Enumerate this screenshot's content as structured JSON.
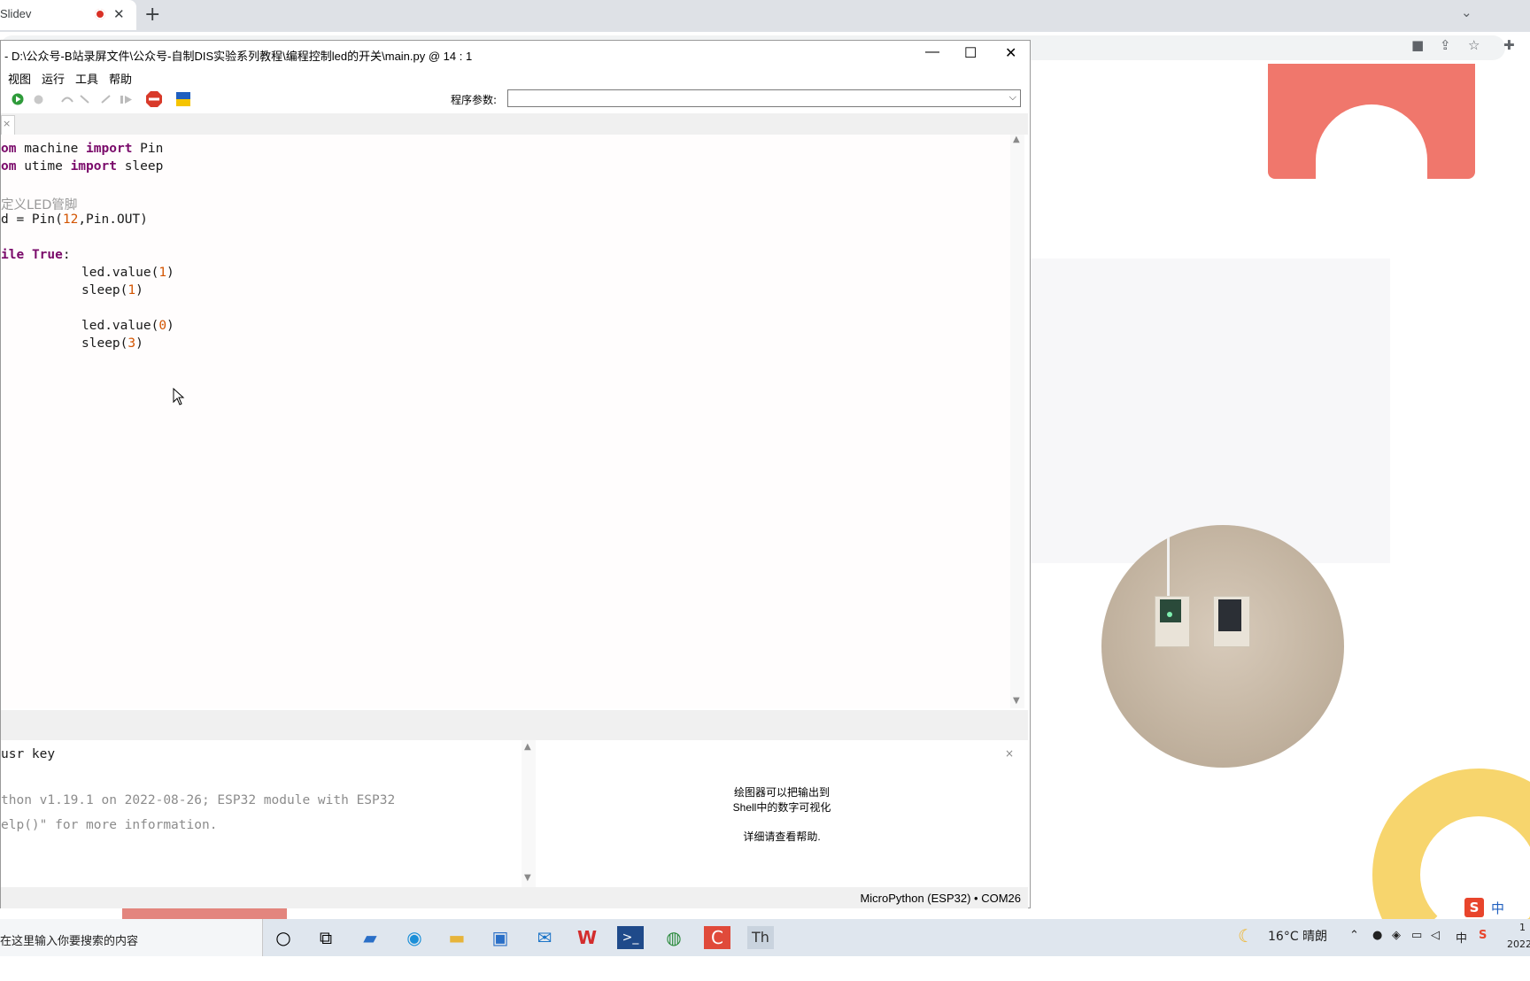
{
  "browser": {
    "tab_title": "Slidev",
    "tab_close": "✕",
    "new_tab": "+",
    "tab_search": "⌄"
  },
  "thonny": {
    "title": "- D:\\公众号-B站录屏文件\\公众号-自制DIS实验系列教程\\编程控制led的开关\\main.py  @  14 : 1",
    "window_buttons": {
      "minimize": "—",
      "maximize": "☐",
      "close": "✕"
    },
    "menu": [
      "视图",
      "运行",
      "工具",
      "帮助"
    ],
    "args_label": "程序参数:",
    "args_value": "",
    "editor_tab_close": "×",
    "code": {
      "l1_a": "om",
      "l1_b": " machine ",
      "l1_c": "import",
      "l1_d": " Pin",
      "l2_a": "om",
      "l2_b": " utime ",
      "l2_c": "import",
      "l2_d": " sleep",
      "l4": "定义LED管脚",
      "l5_a": "d = Pin(",
      "l5_b": "12",
      "l5_c": ",Pin.OUT)",
      "l7_a": "ile",
      "l7_b": " ",
      "l7_c": "True",
      "l7_d": ":",
      "l8_a": "led.value(",
      "l8_b": "1",
      "l8_c": ")",
      "l9_a": "sleep(",
      "l9_b": "1",
      "l9_c": ")",
      "l11_a": "led.value(",
      "l11_b": "0",
      "l11_c": ")",
      "l12_a": "sleep(",
      "l12_b": "3",
      "l12_c": ")"
    },
    "shell": {
      "line1": "usr key",
      "line2": "thon v1.19.1 on 2022-08-26; ESP32 module with ESP32",
      "line3": "elp()\" for more information."
    },
    "plotter": {
      "line1": "绘图器可以把输出到",
      "line2": "Shell中的数字可视化",
      "line3": "详细请查看帮助.",
      "close": "×"
    },
    "status": "MicroPython (ESP32)  •  COM26"
  },
  "taskbar": {
    "search_text": "在这里输入你要搜索的内容",
    "weather": "16°C  晴朗",
    "tray_lang": "中",
    "clock_top": "1",
    "clock_bottom": "2022"
  },
  "ime": {
    "label": "中"
  },
  "colors": {
    "keyword": "#7a0a6a",
    "number": "#d35400",
    "comment": "#999999",
    "slide_red": "#f0776c",
    "slide_yellow": "#f7d56d"
  }
}
